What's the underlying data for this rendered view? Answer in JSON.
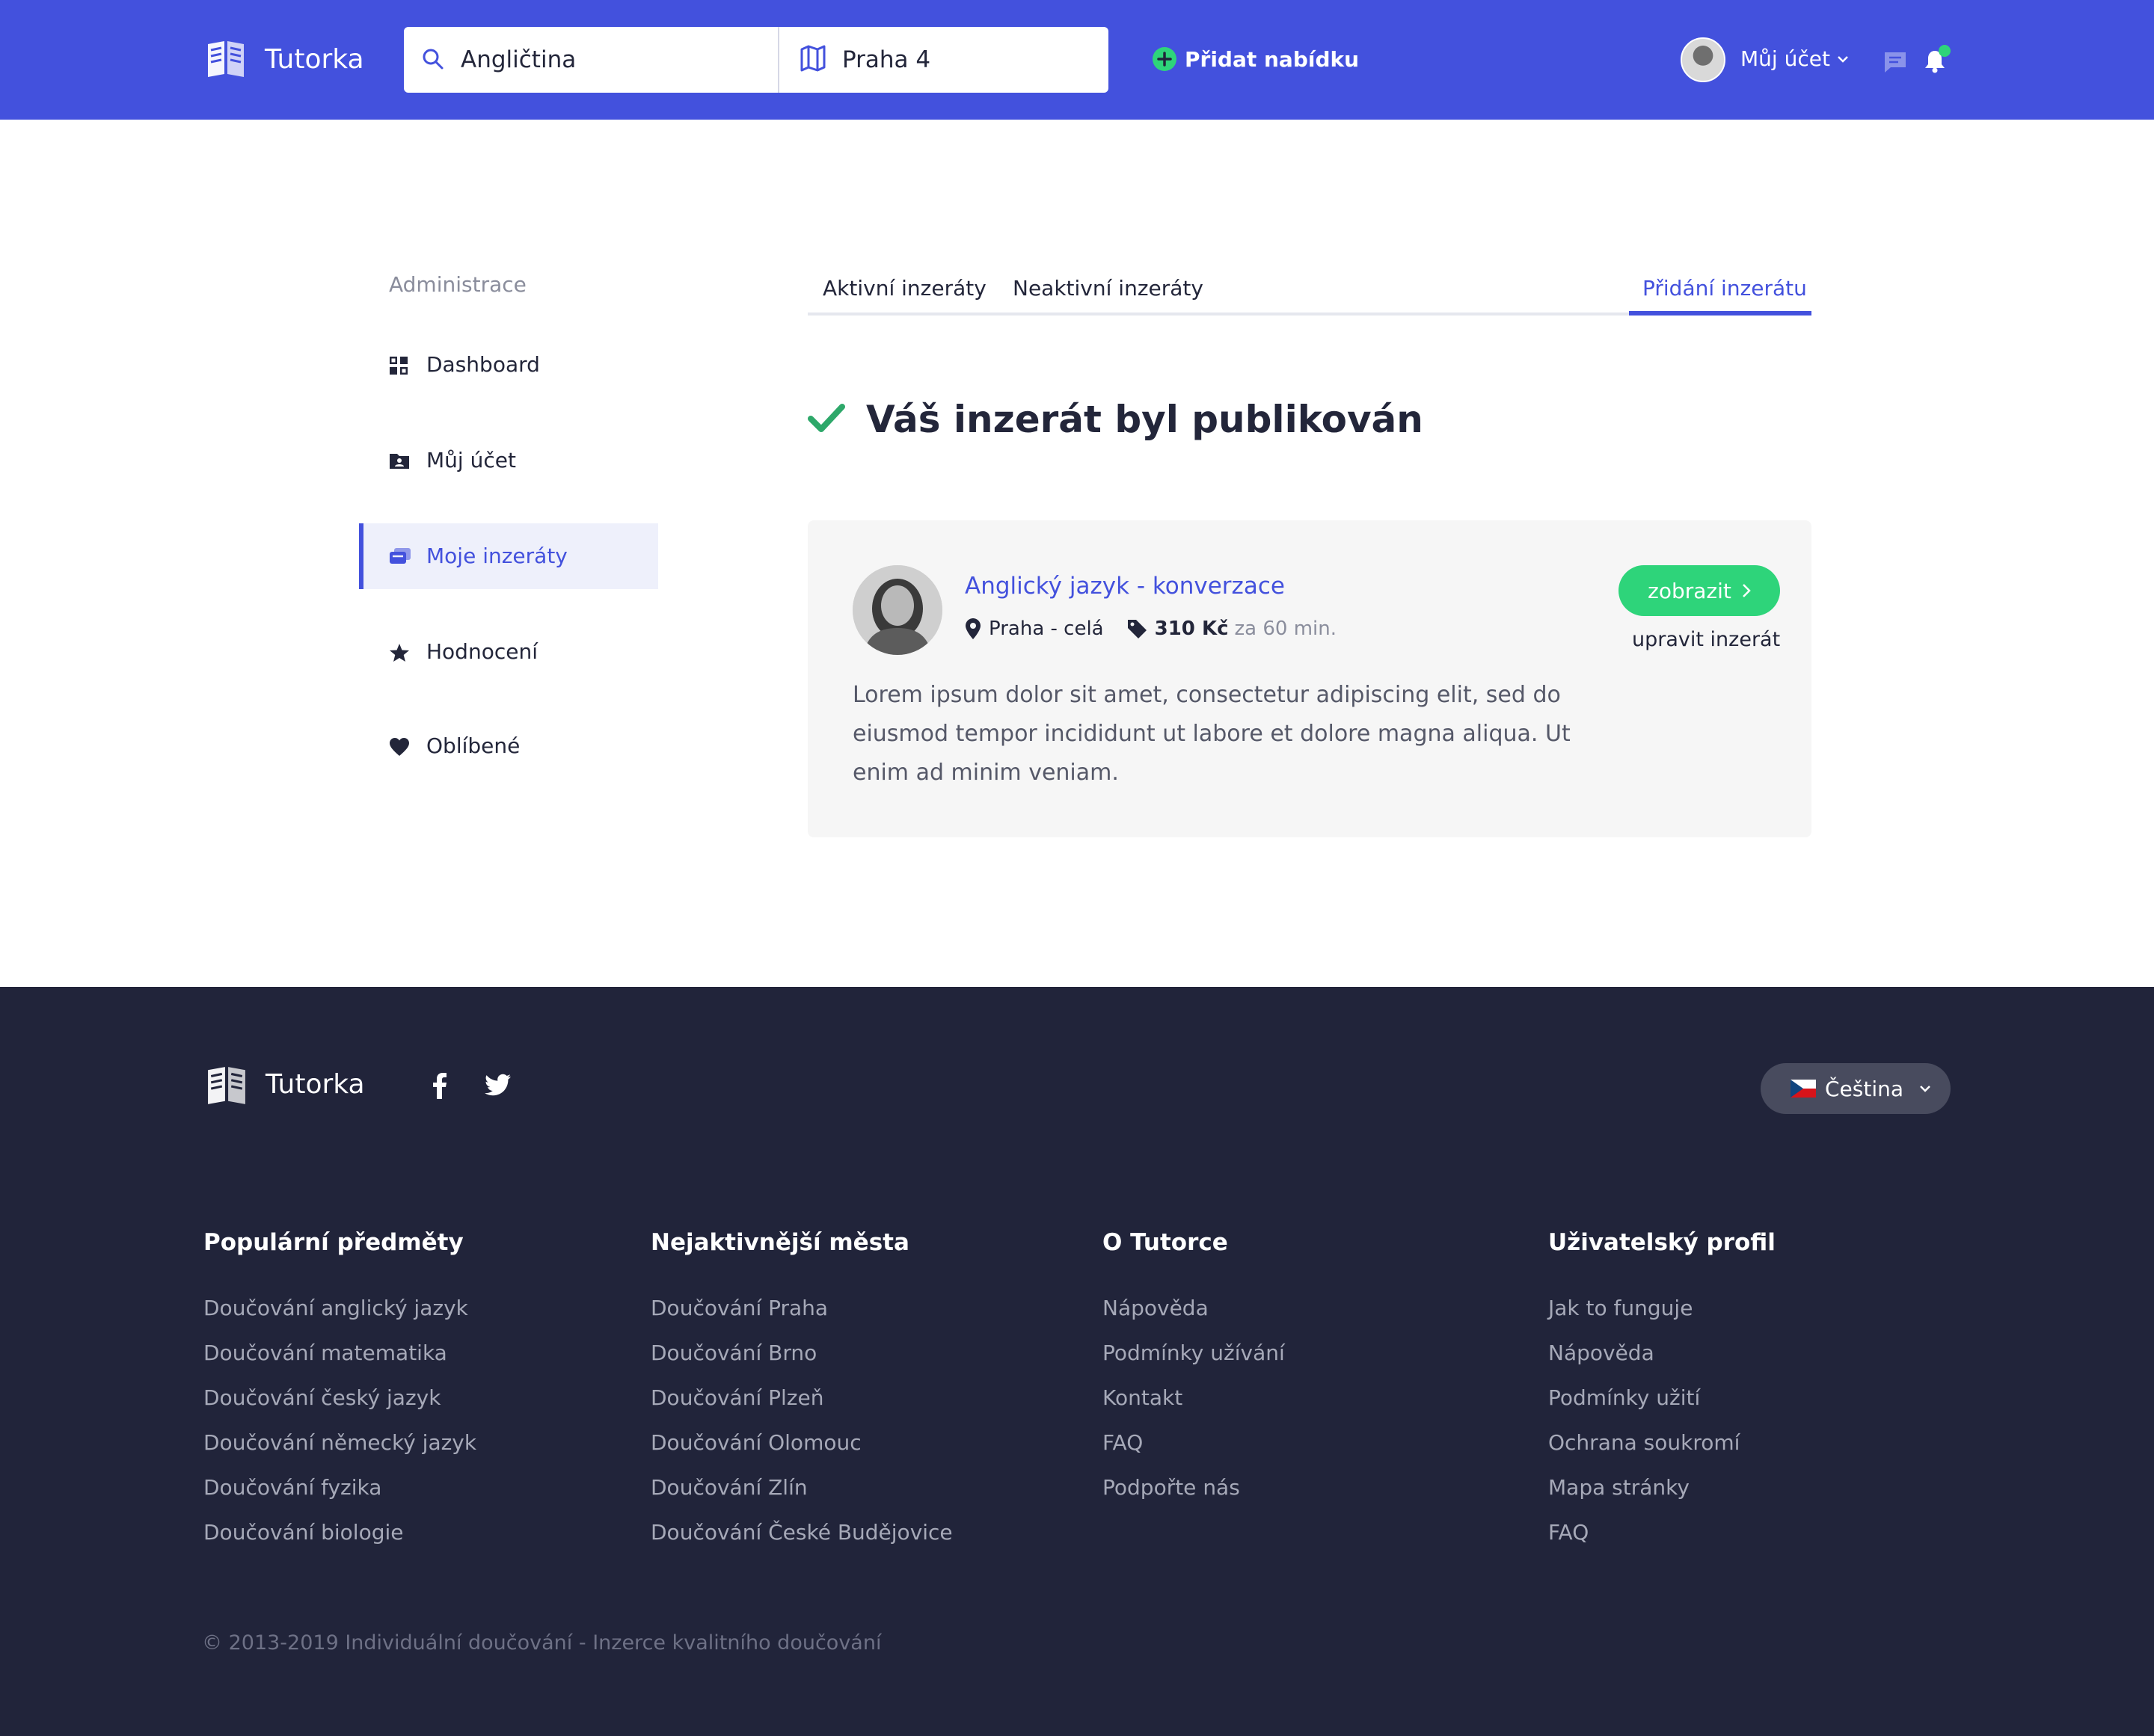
{
  "header": {
    "logo_text": "Tutorka",
    "search_subject": "Angličtina",
    "search_location": "Praha 4",
    "add_offer_label": "Přidat nabídku",
    "account_label": "Můj účet"
  },
  "sidebar": {
    "title": "Administrace",
    "items": [
      {
        "label": "Dashboard",
        "icon": "dashboard-icon"
      },
      {
        "label": "Můj účet",
        "icon": "account-folder-icon"
      },
      {
        "label": "Moje inzeráty",
        "icon": "listings-icon",
        "active": true
      },
      {
        "label": "Hodnocení",
        "icon": "star-icon"
      },
      {
        "label": "Oblíbené",
        "icon": "heart-icon"
      }
    ]
  },
  "tabs": [
    {
      "label": "Aktivní inzeráty"
    },
    {
      "label": "Neaktivní inzeráty"
    },
    {
      "label": "Přidání inzerátu",
      "active": true
    }
  ],
  "success_message": "Váš inzerát byl publikován",
  "listing": {
    "title": "Anglický jazyk - konverzace",
    "location": "Praha - celá",
    "price": "310 Kč",
    "price_unit": "za 60 min.",
    "description": "Lorem ipsum dolor sit amet, consectetur adipiscing elit, sed do eiusmod tempor incididunt ut labore et dolore magna aliqua. Ut enim ad minim veniam.",
    "show_label": "zobrazit",
    "edit_label": "upravit inzerát"
  },
  "footer": {
    "logo_text": "Tutorka",
    "language": "Čeština",
    "columns": [
      {
        "title": "Populární předměty",
        "links": [
          "Doučování anglický jazyk",
          "Doučování matematika",
          "Doučování český jazyk",
          "Doučování německý jazyk",
          "Doučování fyzika",
          "Doučování biologie"
        ]
      },
      {
        "title": "Nejaktivnější města",
        "links": [
          "Doučování Praha",
          "Doučování Brno",
          "Doučování Plzeň",
          "Doučování Olomouc",
          "Doučování Zlín",
          "Doučování České Budějovice"
        ]
      },
      {
        "title": "O Tutorce",
        "links": [
          "Nápověda",
          "Podmínky užívání",
          "Kontakt",
          "FAQ",
          "Podpořte nás"
        ]
      },
      {
        "title": "Uživatelský profil",
        "links": [
          "Jak to funguje",
          "Nápověda",
          "Podmínky užití",
          "Ochrana soukromí",
          "Mapa stránky",
          "FAQ"
        ]
      }
    ],
    "copyright": "© 2013-2019 Individuální doučování - Inzerce kvalitního doučování"
  },
  "colors": {
    "primary": "#4351dd",
    "success": "#2ed47a",
    "footer_bg": "#21243a",
    "card_bg": "#f6f6f6"
  }
}
